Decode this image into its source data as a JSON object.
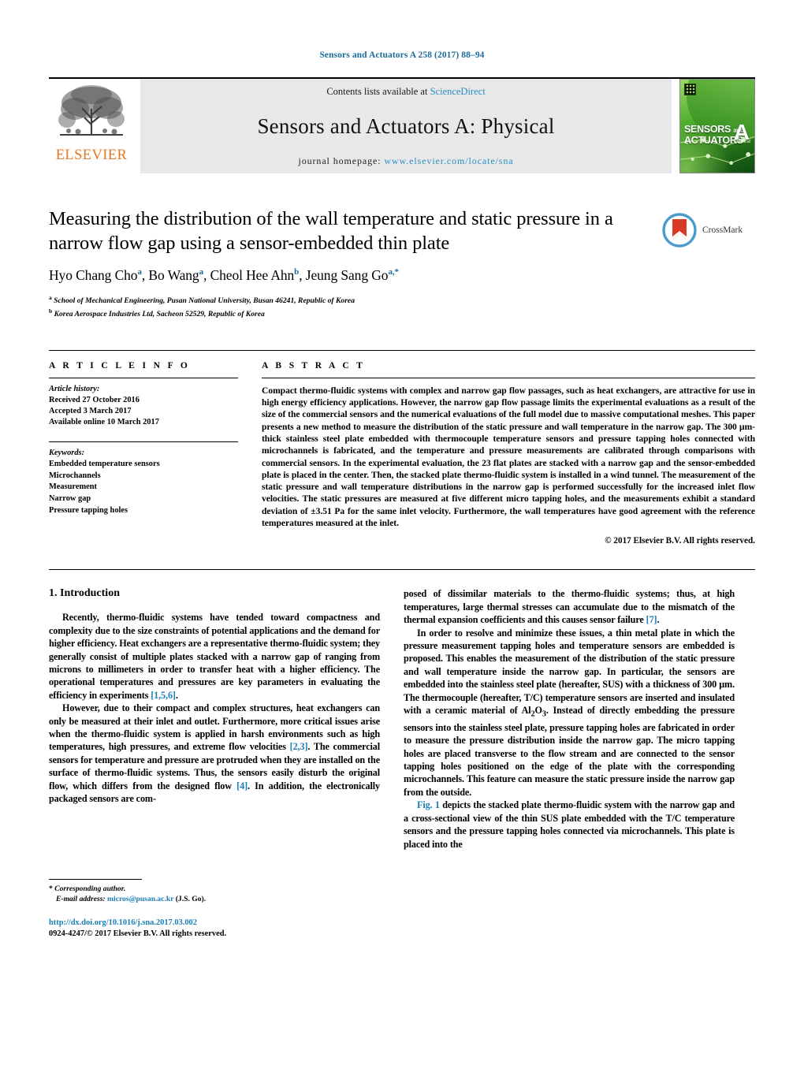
{
  "running_head": "Sensors and Actuators A 258 (2017) 88–94",
  "masthead": {
    "publisher_name": "ELSEVIER",
    "contents_prefix": "Contents lists available at ",
    "contents_link": "ScienceDirect",
    "journal_title": "Sensors and Actuators A: Physical",
    "homepage_prefix": "journal homepage: ",
    "homepage_url": "www.elsevier.com/locate/sna",
    "cover": {
      "line1": "SENSORS",
      "line1_small": "and",
      "line2": "ACTUATORS",
      "letter": "A",
      "sub": "Physical"
    }
  },
  "article": {
    "title": "Measuring the distribution of the wall temperature and static pressure in a narrow flow gap using a sensor-embedded thin plate",
    "authors": [
      {
        "name": "Hyo Chang Cho",
        "marks": "a"
      },
      {
        "name": "Bo Wang",
        "marks": "a"
      },
      {
        "name": "Cheol Hee Ahn",
        "marks": "b"
      },
      {
        "name": "Jeung Sang Go",
        "marks": "a,*"
      }
    ],
    "affiliations": [
      {
        "mark": "a",
        "text": "School of Mechanical Engineering, Pusan National University, Busan 46241, Republic of Korea"
      },
      {
        "mark": "b",
        "text": "Korea Aerospace Industries Ltd, Sacheon 52529, Republic of Korea"
      }
    ],
    "crossmark_label": "CrossMark"
  },
  "info": {
    "heading": "A R T I C L E   I N F O",
    "history_label": "Article history:",
    "history": [
      "Received 27 October 2016",
      "Accepted 3 March 2017",
      "Available online 10 March 2017"
    ],
    "keywords_label": "Keywords:",
    "keywords": [
      "Embedded temperature sensors",
      "Microchannels",
      "Measurement",
      "Narrow gap",
      "Pressure tapping holes"
    ]
  },
  "abstract": {
    "heading": "A B S T R A C T",
    "text": "Compact thermo-fluidic systems with complex and narrow gap flow passages, such as heat exchangers, are attractive for use in high energy efficiency applications. However, the narrow gap flow passage limits the experimental evaluations as a result of the size of the commercial sensors and the numerical evaluations of the full model due to massive computational meshes. This paper presents a new method to measure the distribution of the static pressure and wall temperature in the narrow gap. The 300 μm-thick stainless steel plate embedded with thermocouple temperature sensors and pressure tapping holes connected with microchannels is fabricated, and the temperature and pressure measurements are calibrated through comparisons with commercial sensors. In the experimental evaluation, the 23 flat plates are stacked with a narrow gap and the sensor-embedded plate is placed in the center. Then, the stacked plate thermo-fluidic system is installed in a wind tunnel. The measurement of the static pressure and wall temperature distributions in the narrow gap is performed successfully for the increased inlet flow velocities. The static pressures are measured at five different micro tapping holes, and the measurements exhibit a standard deviation of ±3.51 Pa for the same inlet velocity. Furthermore, the wall temperatures have good agreement with the reference temperatures measured at the inlet.",
    "copyright": "© 2017 Elsevier B.V. All rights reserved."
  },
  "body": {
    "section_number_title": "1.  Introduction",
    "left_paragraphs": [
      "Recently, thermo-fluidic systems have tended toward compactness and complexity due to the size constraints of potential applications and the demand for higher efficiency. Heat exchangers are a representative thermo-fluidic system; they generally consist of multiple plates stacked with a narrow gap of ranging from microns to millimeters in order to transfer heat with a higher efficiency. The operational temperatures and pressures are key parameters in evaluating the efficiency in experiments [1,5,6].",
      "However, due to their compact and complex structures, heat exchangers can only be measured at their inlet and outlet. Furthermore, more critical issues arise when the thermo-fluidic system is applied in harsh environments such as high temperatures, high pressures, and extreme flow velocities [2,3]. The commercial sensors for temperature and pressure are protruded when they are installed on the surface of thermo-fluidic systems. Thus, the sensors easily disturb the original flow, which differs from the designed flow [4]. In addition, the electronically packaged sensors are com-"
    ],
    "right_paragraphs": [
      "posed of dissimilar materials to the thermo-fluidic systems; thus, at high temperatures, large thermal stresses can accumulate due to the mismatch of the thermal expansion coefficients and this causes sensor failure [7].",
      "In order to resolve and minimize these issues, a thin metal plate in which the pressure measurement tapping holes and temperature sensors are embedded is proposed. This enables the measurement of the distribution of the static pressure and wall temperature inside the narrow gap. In particular, the sensors are embedded into the stainless steel plate (hereafter, SUS) with a thickness of 300 μm. The thermocouple (hereafter, T/C) temperature sensors are inserted and insulated with a ceramic material of Al2O3. Instead of directly embedding the pressure sensors into the stainless steel plate, pressure tapping holes are fabricated in order to measure the pressure distribution inside the narrow gap. The micro tapping holes are placed transverse to the flow stream and are connected to the sensor tapping holes positioned on the edge of the plate with the corresponding microchannels. This feature can measure the static pressure inside the narrow gap from the outside.",
      "Fig. 1 depicts the stacked plate thermo-fluidic system with the narrow gap and a cross-sectional view of the thin SUS plate embedded with the T/C temperature sensors and the pressure tapping holes connected via microchannels. This plate is placed into the"
    ],
    "citations": [
      "[1,5,6]",
      "[2,3]",
      "[4]",
      "[7]",
      "Fig. 1"
    ]
  },
  "footer": {
    "corresponding_marker": "*",
    "corresponding_label": "Corresponding author.",
    "email_label": "E-mail address:",
    "email": "micros@pusan.ac.kr",
    "email_owner": "(J.S. Go).",
    "doi_url": "http://dx.doi.org/10.1016/j.sna.2017.03.002",
    "issn_line": "0924-4247/© 2017 Elsevier B.V. All rights reserved."
  },
  "colors": {
    "link_blue": "#1a7fb5",
    "header_blue": "#1a6b99",
    "elsevier_orange": "#E87722",
    "band_gray": "#e8e8e8"
  }
}
